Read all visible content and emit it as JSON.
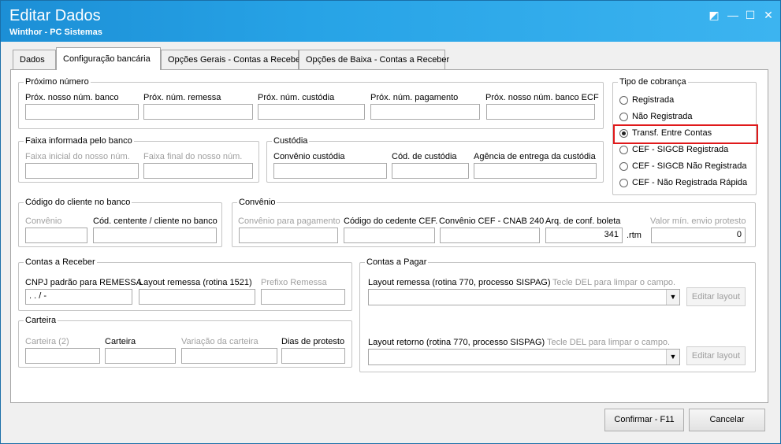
{
  "window": {
    "title": "Editar Dados",
    "subtitle": "Winthor - PC Sistemas",
    "controls": {
      "help": "◩",
      "minimize": "—",
      "maximize": "☐",
      "close": "✕"
    }
  },
  "tabs": [
    {
      "label": "Dados"
    },
    {
      "label": "Configuração bancária"
    },
    {
      "label": "Opções Gerais - Contas a Receber"
    },
    {
      "label": "Opções de Baixa - Contas a Receber"
    }
  ],
  "proximo_numero": {
    "legend": "Próximo número",
    "fields": [
      {
        "label": "Próx. nosso núm. banco",
        "value": ""
      },
      {
        "label": "Próx. núm. remessa",
        "value": ""
      },
      {
        "label": "Próx. núm. custódia",
        "value": ""
      },
      {
        "label": "Próx. núm. pagamento",
        "value": ""
      },
      {
        "label": "Próx. nosso núm. banco ECF",
        "value": ""
      }
    ]
  },
  "tipo_cobranca": {
    "legend": "Tipo de cobrança",
    "options": [
      {
        "label": "Registrada",
        "checked": false
      },
      {
        "label": "Não Registrada",
        "checked": false
      },
      {
        "label": "Transf. Entre Contas",
        "checked": true
      },
      {
        "label": "CEF - SIGCB Registrada",
        "checked": false
      },
      {
        "label": "CEF - SIGCB Não Registrada",
        "checked": false
      },
      {
        "label": "CEF - Não Registrada Rápida",
        "checked": false
      }
    ],
    "highlight_color": "#e0191b"
  },
  "faixa": {
    "legend": "Faixa informada pelo banco",
    "inicial_label": "Faixa inicial do nosso núm.",
    "final_label": "Faixa final do nosso núm."
  },
  "custodia": {
    "legend": "Custódia",
    "convenio_label": "Convênio custódia",
    "codigo_label": "Cód. de custódia",
    "agencia_label": "Agência de entrega da custódia"
  },
  "codigo_cliente": {
    "legend": "Código do cliente no banco",
    "convenio_label": "Convênio",
    "cedente_label": "Cód. centente / cliente no banco"
  },
  "convenio": {
    "legend": "Convênio",
    "pagamento_label": "Convênio para pagamento",
    "cedente_cef_label": "Código do cedente CEF.",
    "cnab_label": "Convênio CEF - CNAB 240",
    "arq_label": "Arq. de conf. boleta",
    "arq_value": "341",
    "arq_ext": ".rtm",
    "valor_min_label": "Valor mín. envio protesto",
    "valor_min_value": "0"
  },
  "contas_receber": {
    "legend": "Contas a Receber",
    "cnpj_label": "CNPJ padrão para REMESSA",
    "cnpj_value": " .  .   /    -",
    "layout_label": "Layout remessa (rotina 1521)",
    "prefixo_label": "Prefixo Remessa"
  },
  "carteira": {
    "legend": "Carteira",
    "carteira2_label": "Carteira (2)",
    "carteira_label": "Carteira",
    "variacao_label": "Variação da carteira",
    "dias_label": "Dias de protesto"
  },
  "contas_pagar": {
    "legend": "Contas a Pagar",
    "remessa_label": "Layout remessa (rotina 770, processo SISPAG)",
    "retorno_label": "Layout retorno (rotina 770, processo SISPAG)",
    "hint": "Tecle DEL para limpar o campo.",
    "editar_label": "Editar layout"
  },
  "footer": {
    "confirmar": "Confirmar - F11",
    "cancelar": "Cancelar"
  }
}
